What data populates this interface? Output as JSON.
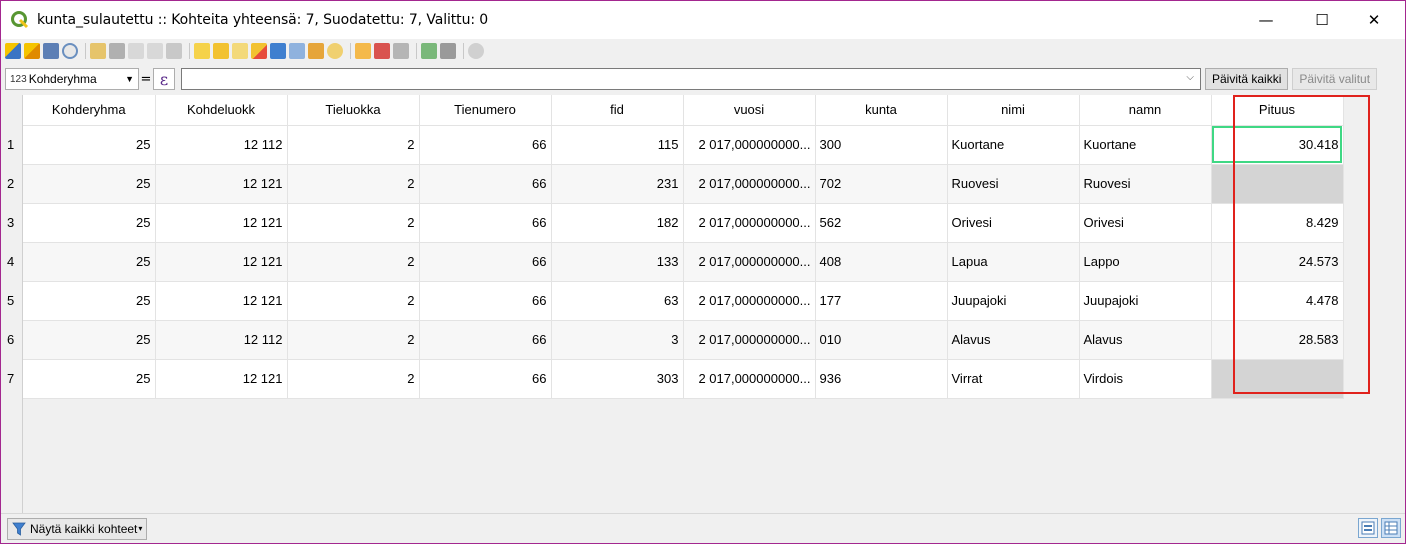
{
  "window": {
    "title": "kunta_sulautettu :: Kohteita yhteensä: 7, Suodatettu: 7, Valittu: 0",
    "minimize_icon": "—",
    "maximize_icon": "☐",
    "close_icon": "✕"
  },
  "toolbar": {
    "icons": [
      "pencil-icon",
      "multi-edit-icon",
      "save-icon",
      "reload-icon",
      "add-feature-icon",
      "delete-icon",
      "cut-icon",
      "copy-icon",
      "paste-icon",
      "expression-select-icon",
      "select-all-icon",
      "invert-selection-icon",
      "deselect-icon",
      "filter-selected-icon",
      "move-selection-top-icon",
      "pan-to-selection-icon",
      "zoom-to-selection-icon",
      "new-field-icon",
      "delete-field-icon",
      "field-calculator-icon",
      "conditional-formatting-icon",
      "actions-icon",
      "dock-icon"
    ]
  },
  "expression_bar": {
    "field_type": "123",
    "field_name": "Kohderyhma",
    "equals": "=",
    "epsilon": "ε",
    "expression_value": "",
    "update_all_label": "Päivitä kaikki",
    "update_selected_label": "Päivitä valitut"
  },
  "table": {
    "columns": [
      "Kohderyhma",
      "Kohdeluokk",
      "Tieluokka",
      "Tienumero",
      "fid",
      "vuosi",
      "kunta",
      "nimi",
      "namn",
      "Pituus"
    ],
    "rows": [
      {
        "row": "1",
        "cells": [
          "25",
          "12 112",
          "2",
          "66",
          "115",
          "2 017,000000000...",
          "300",
          "Kuortane",
          "Kuortane",
          "30.418"
        ]
      },
      {
        "row": "2",
        "cells": [
          "25",
          "12 121",
          "2",
          "66",
          "231",
          "2 017,000000000...",
          "702",
          "Ruovesi",
          "Ruovesi",
          ""
        ]
      },
      {
        "row": "3",
        "cells": [
          "25",
          "12 121",
          "2",
          "66",
          "182",
          "2 017,000000000...",
          "562",
          "Orivesi",
          "Orivesi",
          "8.429"
        ]
      },
      {
        "row": "4",
        "cells": [
          "25",
          "12 121",
          "2",
          "66",
          "133",
          "2 017,000000000...",
          "408",
          "Lapua",
          "Lappo",
          "24.573"
        ]
      },
      {
        "row": "5",
        "cells": [
          "25",
          "12 121",
          "2",
          "66",
          "63",
          "2 017,000000000...",
          "177",
          "Juupajoki",
          "Juupajoki",
          "4.478"
        ]
      },
      {
        "row": "6",
        "cells": [
          "25",
          "12 112",
          "2",
          "66",
          "3",
          "2 017,000000000...",
          "010",
          "Alavus",
          "Alavus",
          "28.583"
        ]
      },
      {
        "row": "7",
        "cells": [
          "25",
          "12 121",
          "2",
          "66",
          "303",
          "2 017,000000000...",
          "936",
          "Virrat",
          "Virdois",
          ""
        ]
      }
    ]
  },
  "footer": {
    "show_all_label": "Näytä kaikki kohteet"
  },
  "colors": {
    "window_border": "#a3278f",
    "highlight_box": "#e0221c",
    "selected_cell_outline": "#3fd884",
    "empty_cell": "#d4d4d4"
  }
}
